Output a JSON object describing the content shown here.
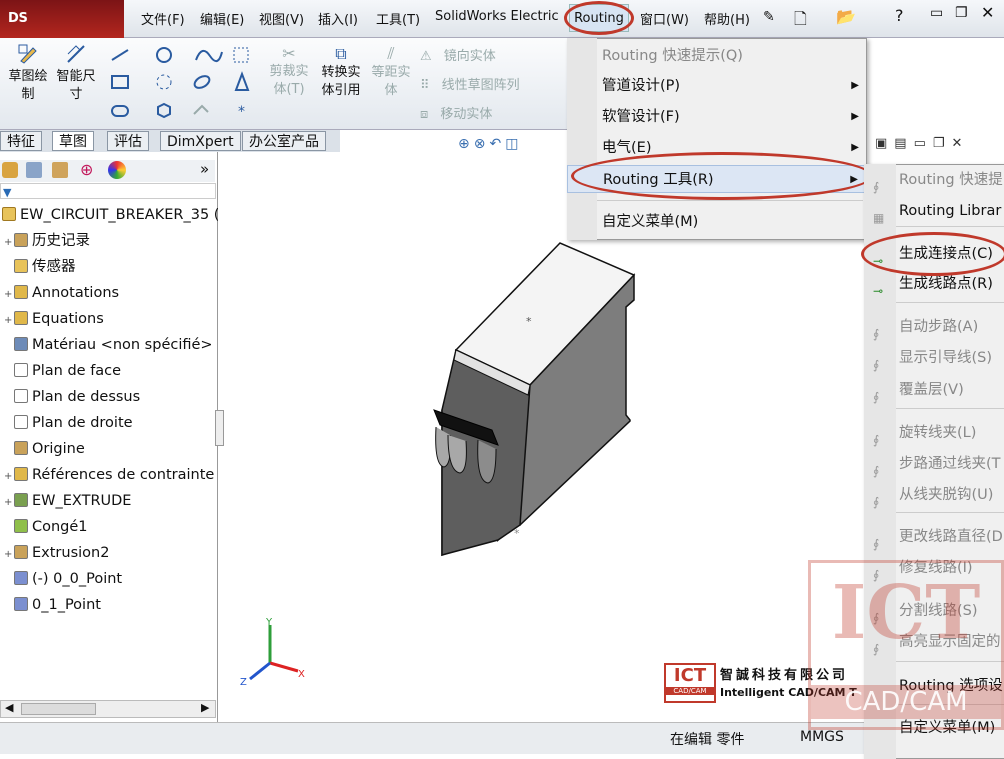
{
  "app": {
    "logo_text": "DS SOLIDWORKS"
  },
  "menubar": {
    "items": [
      "文件(F)",
      "编辑(E)",
      "视图(V)",
      "插入(I)",
      "工具(T)",
      "SolidWorks Electrical",
      "Routing",
      "窗口(W)",
      "帮助(H)"
    ]
  },
  "ribbon": {
    "sketch_draw": "草图绘\n制",
    "smart_dim": "智能尺\n寸",
    "trim": "剪裁实\n体(T)",
    "convert": "转换实\n体引用",
    "offset": "等距实\n体",
    "mirror": "镜向实体",
    "linear_pattern": "线性草图阵列",
    "move": "移动实体"
  },
  "tabs": [
    "特征",
    "草图",
    "评估",
    "DimXpert",
    "办公室产品"
  ],
  "tree": {
    "root": "EW_CIRCUIT_BREAKER_35",
    "root_suffix": "(",
    "items": [
      {
        "label": "历史记录",
        "expander": "+"
      },
      {
        "label": "传感器",
        "expander": ""
      },
      {
        "label": "Annotations",
        "expander": "+"
      },
      {
        "label": "Equations",
        "expander": "+"
      },
      {
        "label": "Matériau <non spécifié>",
        "expander": ""
      },
      {
        "label": "Plan de face",
        "expander": ""
      },
      {
        "label": "Plan de dessus",
        "expander": ""
      },
      {
        "label": "Plan de droite",
        "expander": ""
      },
      {
        "label": "Origine",
        "expander": ""
      },
      {
        "label": "Références de contrainte",
        "expander": "+"
      },
      {
        "label": "EW_EXTRUDE",
        "expander": "+"
      },
      {
        "label": "Congé1",
        "expander": ""
      },
      {
        "label": "Extrusion2",
        "expander": "+"
      },
      {
        "label": "(-) 0_0_Point",
        "expander": ""
      },
      {
        "label": "0_1_Point",
        "expander": ""
      }
    ]
  },
  "routing_menu": {
    "items": [
      {
        "label": "Routing 快速提示(Q)",
        "disabled": true,
        "submenu": false
      },
      {
        "label": "管道设计(P)",
        "disabled": false,
        "submenu": true
      },
      {
        "label": "软管设计(F)",
        "disabled": false,
        "submenu": true
      },
      {
        "label": "电气(E)",
        "disabled": false,
        "submenu": true
      },
      {
        "label": "Routing 工具(R)",
        "disabled": false,
        "submenu": true
      },
      {
        "label": "自定义菜单(M)",
        "disabled": false,
        "submenu": false
      }
    ]
  },
  "tools_submenu": {
    "items": [
      {
        "label": "Routing 快速提",
        "disabled": true
      },
      {
        "label": "Routing Librar",
        "disabled": false
      },
      {
        "label": "生成连接点(C)",
        "disabled": false
      },
      {
        "label": "生成线路点(R)",
        "disabled": false
      },
      {
        "label": "自动步路(A)",
        "disabled": true
      },
      {
        "label": "显示引导线(S)",
        "disabled": true
      },
      {
        "label": "覆盖层(V)",
        "disabled": true
      },
      {
        "label": "旋转线夹(L)",
        "disabled": true
      },
      {
        "label": "步路通过线夹(T",
        "disabled": true
      },
      {
        "label": "从线夹脱钩(U)",
        "disabled": true
      },
      {
        "label": "更改线路直径(D",
        "disabled": true
      },
      {
        "label": "修复线路(I)",
        "disabled": true
      },
      {
        "label": "分割线路(S)",
        "disabled": true
      },
      {
        "label": "高亮显示固定的",
        "disabled": true
      },
      {
        "label": "Routing 选项设",
        "disabled": false
      },
      {
        "label": "自定义菜单(M)",
        "disabled": false
      }
    ]
  },
  "watermark": {
    "ict": "ICT",
    "cad_cam": "CAD/CAM",
    "company_cn": "智誠科技有限公司",
    "company_en": "Intelligent CAD/CAM T"
  },
  "status": {
    "editing": "在编辑 零件",
    "units": "MMGS"
  },
  "triad": {
    "x": "X",
    "y": "Y",
    "z": "Z"
  }
}
